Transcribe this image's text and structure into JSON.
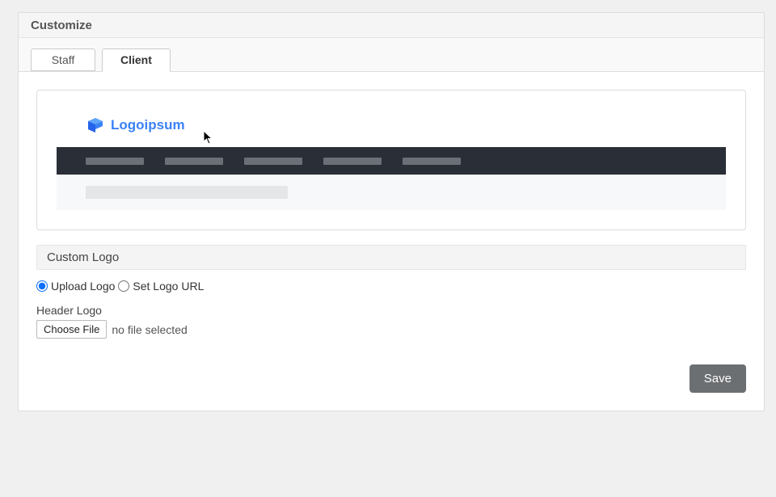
{
  "header": {
    "title": "Customize"
  },
  "tabs": [
    {
      "id": "staff",
      "label": "Staff",
      "active": false
    },
    {
      "id": "client",
      "label": "Client",
      "active": true
    }
  ],
  "preview": {
    "logo_text": "Logoipsum"
  },
  "custom_logo": {
    "section_title": "Custom Logo",
    "options": {
      "upload_label": "Upload Logo",
      "url_label": "Set Logo URL",
      "selected": "upload"
    },
    "field_label": "Header Logo",
    "choose_button": "Choose File",
    "file_status": "no file selected"
  },
  "actions": {
    "save_label": "Save"
  }
}
